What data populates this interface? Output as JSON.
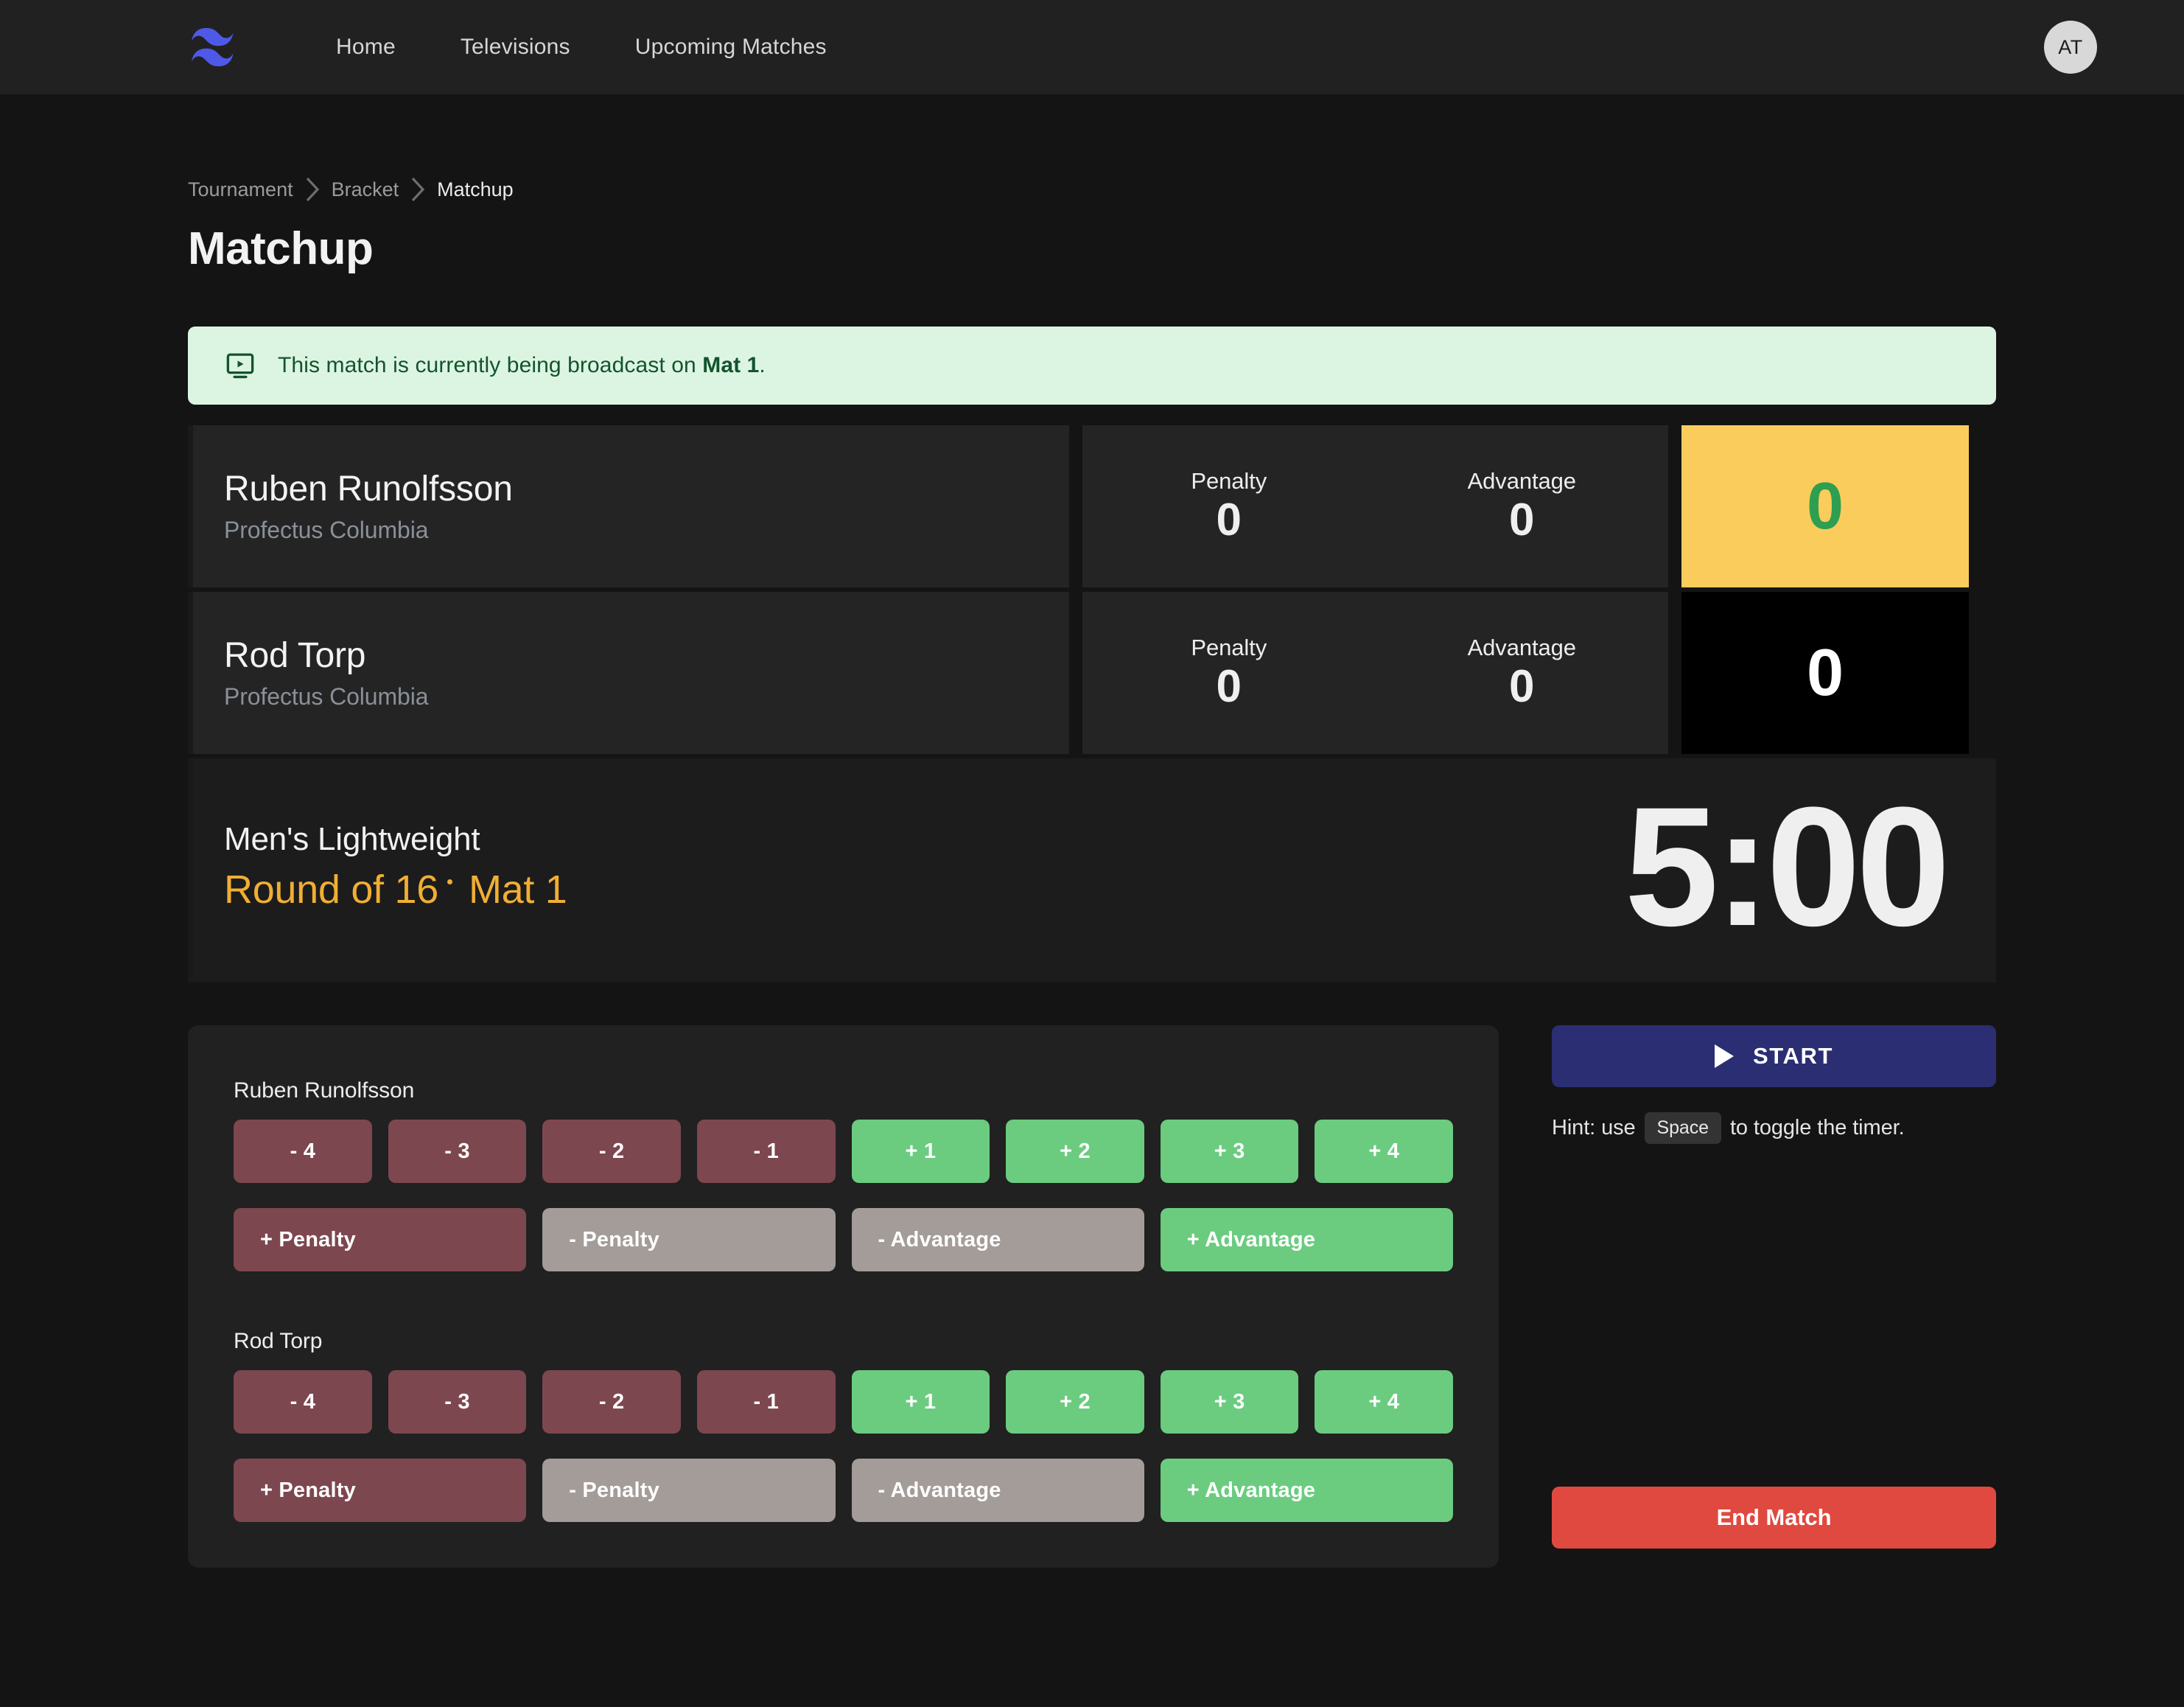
{
  "navbar": {
    "logo_name": "tailwind-wave-logo",
    "links": [
      {
        "label": "Home"
      },
      {
        "label": "Televisions"
      },
      {
        "label": "Upcoming Matches"
      }
    ],
    "avatar_initials": "AT"
  },
  "breadcrumb": {
    "items": [
      {
        "label": "Tournament"
      },
      {
        "label": "Bracket"
      },
      {
        "label": "Matchup"
      }
    ]
  },
  "page": {
    "title": "Matchup"
  },
  "banner": {
    "icon": "tv-play-icon",
    "prefix": "This match is currently being broadcast on ",
    "mat": "Mat 1",
    "suffix": "."
  },
  "scoreboard": {
    "rows": [
      {
        "name": "Ruben Runolfsson",
        "team": "Profectus Columbia",
        "penalty_label": "Penalty",
        "penalty_value": "0",
        "advantage_label": "Advantage",
        "advantage_value": "0",
        "score": "0",
        "score_bg": "#f9cc5c",
        "score_fg": "#2e9e51"
      },
      {
        "name": "Rod Torp",
        "team": "Profectus Columbia",
        "penalty_label": "Penalty",
        "penalty_value": "0",
        "advantage_label": "Advantage",
        "advantage_value": "0",
        "score": "0",
        "score_bg": "#000000",
        "score_fg": "#ffffff"
      }
    ]
  },
  "match_info": {
    "division": "Men's Lightweight",
    "round": "Round of 16",
    "mat": "Mat 1",
    "timer": "5:00"
  },
  "controls": {
    "players": [
      {
        "label": "Ruben Runolfsson",
        "point_buttons": [
          {
            "label": "- 4",
            "kind": "neg"
          },
          {
            "label": "- 3",
            "kind": "neg"
          },
          {
            "label": "- 2",
            "kind": "neg"
          },
          {
            "label": "- 1",
            "kind": "neg"
          },
          {
            "label": "+ 1",
            "kind": "pos"
          },
          {
            "label": "+ 2",
            "kind": "pos"
          },
          {
            "label": "+ 3",
            "kind": "pos"
          },
          {
            "label": "+ 4",
            "kind": "pos"
          }
        ],
        "modifier_buttons": [
          {
            "label": "+ Penalty",
            "kind": "neg"
          },
          {
            "label": "- Penalty",
            "kind": "gray"
          },
          {
            "label": "- Advantage",
            "kind": "gray"
          },
          {
            "label": "+ Advantage",
            "kind": "pos"
          }
        ]
      },
      {
        "label": "Rod Torp",
        "point_buttons": [
          {
            "label": "- 4",
            "kind": "neg"
          },
          {
            "label": "- 3",
            "kind": "neg"
          },
          {
            "label": "- 2",
            "kind": "neg"
          },
          {
            "label": "- 1",
            "kind": "neg"
          },
          {
            "label": "+ 1",
            "kind": "pos"
          },
          {
            "label": "+ 2",
            "kind": "pos"
          },
          {
            "label": "+ 3",
            "kind": "pos"
          },
          {
            "label": "+ 4",
            "kind": "pos"
          }
        ],
        "modifier_buttons": [
          {
            "label": "+ Penalty",
            "kind": "neg"
          },
          {
            "label": "- Penalty",
            "kind": "gray"
          },
          {
            "label": "- Advantage",
            "kind": "gray"
          },
          {
            "label": "+ Advantage",
            "kind": "pos"
          }
        ]
      }
    ]
  },
  "sidebar": {
    "start_label": "START",
    "hint_prefix": "Hint: use",
    "hint_key": "Space",
    "hint_suffix": "to toggle the timer.",
    "end_label": "End Match"
  },
  "colors": {
    "accent_yellow": "#f0ae33",
    "score_yellow": "#f9cc5c",
    "green": "#6bcc80",
    "maroon": "#7d474f",
    "gray": "#a39c99",
    "indigo": "#2b2e72",
    "red": "#e0493f",
    "banner_bg": "#dcf5e3",
    "banner_fg": "#14532d"
  }
}
